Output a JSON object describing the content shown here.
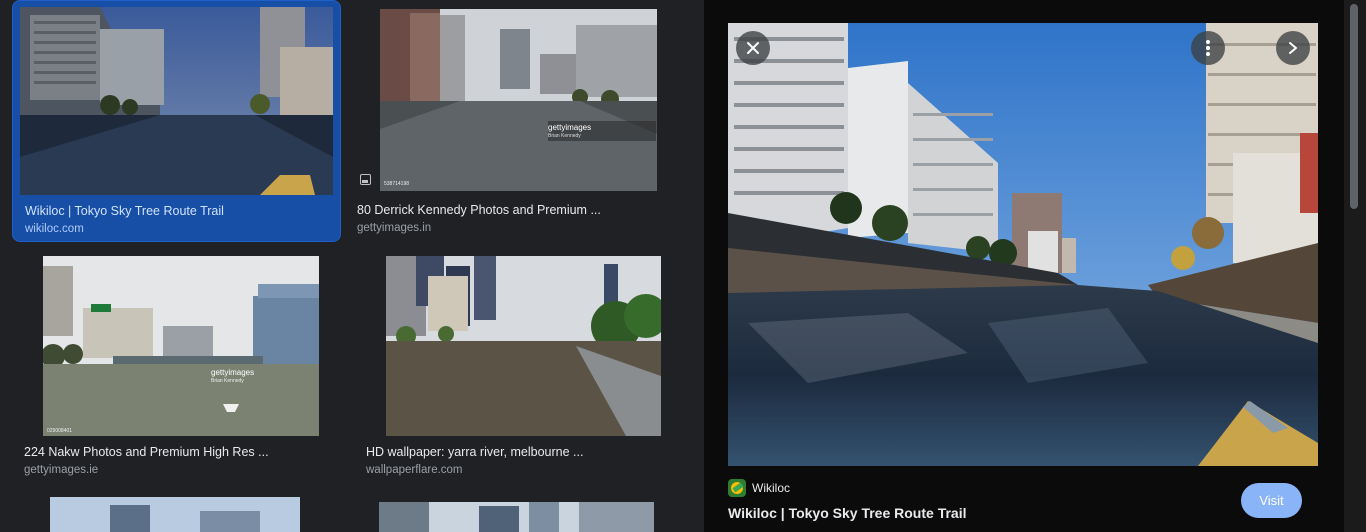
{
  "results": [
    {
      "title": "Wikiloc | Tokyo Sky Tree Route Trail",
      "source": "wikiloc.com",
      "selected": true
    },
    {
      "title": "80 Derrick Kennedy Photos and Premium ...",
      "source": "gettyimages.in",
      "watermark": "gettyimages",
      "watermark_credit": "Brian Kennedy",
      "image_id": "538714198"
    },
    {
      "title": "224 Nakw Photos and Premium High Res ...",
      "source": "gettyimages.ie",
      "watermark": "gettyimages",
      "watermark_credit": "Brian Kennedy",
      "image_id": "029008401"
    },
    {
      "title": "HD wallpaper: yarra river, melbourne ...",
      "source": "wallpaperflare.com"
    }
  ],
  "preview": {
    "source_name": "Wikiloc",
    "title": "Wikiloc | Tokyo Sky Tree Route Trail",
    "visit_label": "Visit",
    "close_icon": "close-icon",
    "more_icon": "more-vert-icon",
    "next_icon": "chevron-right-icon"
  },
  "colors": {
    "background": "#202124",
    "panel_background": "#0b0b0b",
    "selected_card": "#174ea6",
    "visit_button": "#8ab4f8"
  }
}
